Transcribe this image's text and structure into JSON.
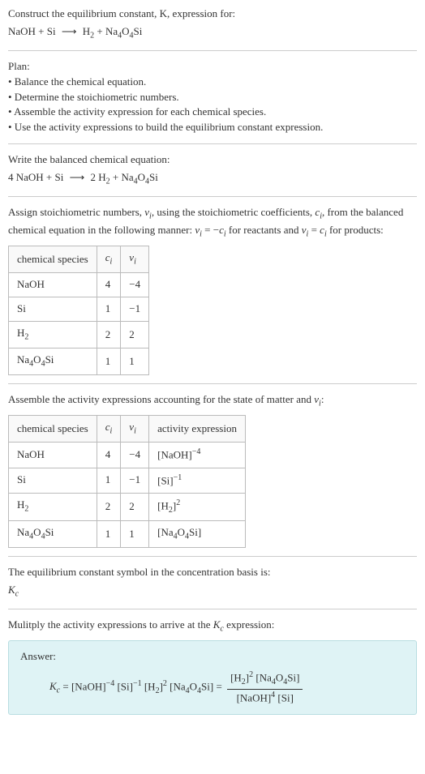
{
  "header_line1": "Construct the equilibrium constant, K, expression for:",
  "plan_heading": "Plan:",
  "plan_items": [
    "• Balance the chemical equation.",
    "• Determine the stoichiometric numbers.",
    "• Assemble the activity expression for each chemical species.",
    "• Use the activity expressions to build the equilibrium constant expression."
  ],
  "balanced_heading": "Write the balanced chemical equation:",
  "stoich_text1": "Assign stoichiometric numbers, ",
  "stoich_text2": ", using the stoichiometric coefficients, ",
  "stoich_text3": ", from the balanced chemical equation in the following manner: ",
  "stoich_text4": " for reactants and ",
  "stoich_text5": " for products:",
  "tbl1": {
    "h1": "chemical species",
    "h2": "cᵢ",
    "h3": "νᵢ",
    "rows": [
      {
        "s": "NaOH",
        "c": "4",
        "v": "−4"
      },
      {
        "s": "Si",
        "c": "1",
        "v": "−1"
      },
      {
        "s": "H₂",
        "c": "2",
        "v": "2"
      },
      {
        "s": "Na₄O₄Si",
        "c": "1",
        "v": "1"
      }
    ]
  },
  "assemble_text1": "Assemble the activity expressions accounting for the state of matter and ",
  "assemble_text2": ":",
  "tbl2": {
    "h1": "chemical species",
    "h2": "cᵢ",
    "h3": "νᵢ",
    "h4": "activity expression",
    "rows": [
      {
        "s": "NaOH",
        "c": "4",
        "v": "−4"
      },
      {
        "s": "Si",
        "c": "1",
        "v": "−1"
      },
      {
        "s": "H₂",
        "c": "2",
        "v": "2"
      },
      {
        "s": "Na₄O₄Si",
        "c": "1",
        "v": "1"
      }
    ]
  },
  "kc_text": "The equilibrium constant symbol in the concentration basis is:",
  "multiply_text1": "Mulitply the activity expressions to arrive at the ",
  "multiply_text2": " expression:",
  "answer_label": "Answer:"
}
